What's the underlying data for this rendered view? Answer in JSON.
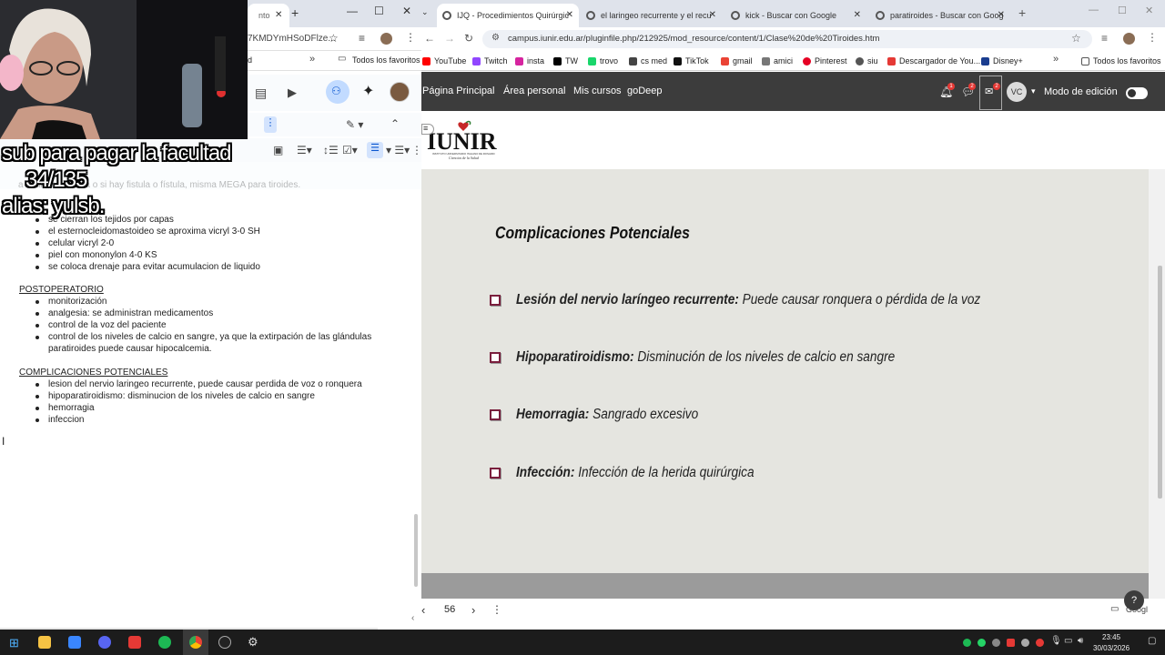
{
  "left_window": {
    "tab_partial": "nto",
    "url_partial": "7KMDYmHSoDFlze...",
    "bookmark_partial": "d",
    "bookmark_all": "Todos los favoritos",
    "doc_lines": {
      "cut_top": "a cuando molesta o si hay fistula o fístula, misma MEGA para tiroides.",
      "bullets_top": [
        "se cierran los tejidos por capas",
        "el esternocleidomastoideo se aproxima vicryl 3-0 SH",
        "celular vicryl 2-0",
        "piel con mononylon 4-0 KS",
        "se coloca drenaje para evitar acumulacion de liquido"
      ],
      "postop_heading": "POSTOPERATORIO",
      "postop_bullets": [
        "monitorización",
        "analgesia: se administran medicamentos",
        "control de la voz del paciente",
        "control de los niveles de calcio en sangre, ya que la extirpación de las glándulas",
        "paratiroides puede causar hipocalcemia."
      ],
      "compl_heading": "COMPLICACIONES POTENCIALES",
      "compl_bullets": [
        "lesion del nervio laringeo recurrente, puede causar perdida de voz o ronquera",
        "hipoparatiroidismo: disminucion de los niveles de calcio en sangre",
        "hemorragia",
        "infeccion"
      ]
    },
    "overlay": {
      "line1": "sub para pagar la facultad",
      "line2": "34/135",
      "line3": "alias: yulsb."
    }
  },
  "right_window": {
    "tabs": [
      {
        "label": "IJQ - Procedimientos Quirúrgic"
      },
      {
        "label": "el laringeo recurrente y el recu"
      },
      {
        "label": "kick - Buscar con Google"
      },
      {
        "label": "paratiroides - Buscar con Goog"
      }
    ],
    "url": "campus.iunir.edu.ar/pluginfile.php/212925/mod_resource/content/1/Clase%20de%20Tiroides.htm",
    "bookmarks": [
      "YouTube",
      "Twitch",
      "insta",
      "TW",
      "trovo",
      "cs med",
      "TikTok",
      "gmail",
      "amici",
      "Pinterest",
      "siu",
      "Descargador de You...",
      "Disney+"
    ],
    "bookmarks_all": "Todos los favoritos",
    "nav": {
      "links": [
        "Página Principal",
        "Área personal",
        "Mis cursos",
        "goDeep"
      ],
      "notif_count": "1",
      "msg_count": "2",
      "mail_count": "2",
      "avatar_initials": "VC",
      "edit_mode_label": "Modo de edición"
    },
    "logo": {
      "name": "IUNIR",
      "subtitle": "INSTITUTO UNIVERSITARIO ITALIANO DE ROSARIO",
      "tagline": "Ciencias de la Salud"
    },
    "slide": {
      "title": "Complicaciones Potenciales",
      "items": [
        {
          "term": "Lesión del nervio laríngeo recurrente:",
          "desc": "Puede causar ronquera o pérdida de la voz"
        },
        {
          "term": "Hipoparatiroidismo:",
          "desc": "Disminución de los niveles de calcio en sangre"
        },
        {
          "term": "Hemorragia:",
          "desc": "Sangrado excesivo"
        },
        {
          "term": "Infección:",
          "desc": "Infección de la herida quirúrgica"
        }
      ]
    },
    "footer": {
      "page_number": "56",
      "right_label": "Googl"
    }
  },
  "taskbar": {
    "time": "23:45",
    "date": "30/03/2026"
  },
  "colors": {
    "moodle_nav": "#3c3c3c",
    "slide_bg": "#e5e5e0",
    "checkbox_border": "#7a1f3d",
    "tab_bar": "#dfe3eb",
    "badge_red": "#e53935"
  }
}
